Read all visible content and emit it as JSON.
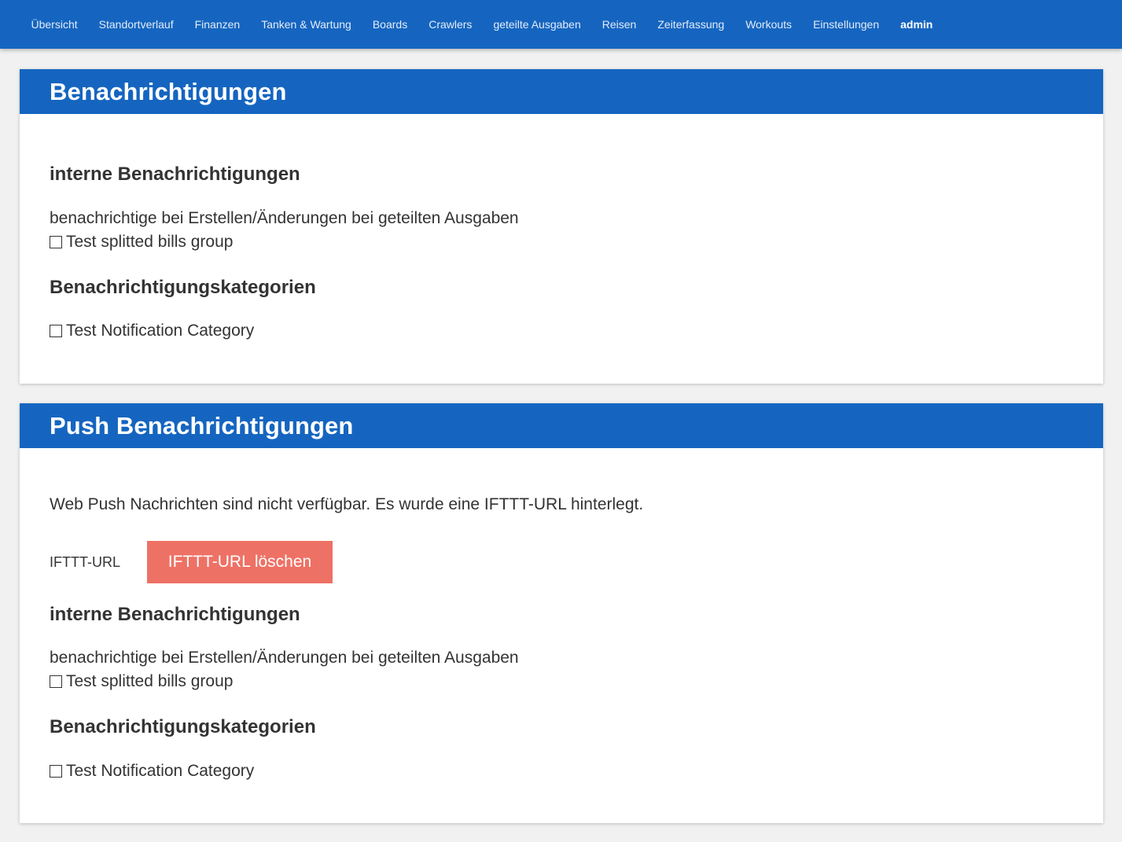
{
  "nav": {
    "items": [
      {
        "label": "Übersicht"
      },
      {
        "label": "Standortverlauf"
      },
      {
        "label": "Finanzen"
      },
      {
        "label": "Tanken & Wartung"
      },
      {
        "label": "Boards"
      },
      {
        "label": "Crawlers"
      },
      {
        "label": "geteilte Ausgaben"
      },
      {
        "label": "Reisen"
      },
      {
        "label": "Zeiterfassung"
      },
      {
        "label": "Workouts"
      },
      {
        "label": "Einstellungen"
      },
      {
        "label": "admin"
      }
    ]
  },
  "notifications": {
    "title": "Benachrichtigungen",
    "internal_heading": "interne Benachrichtigungen",
    "internal_desc": "benachrichtige bei Erstellen/Änderungen bei geteilten Ausgaben",
    "group_option": "Test splitted bills group",
    "categories_heading": "Benachrichtigungskategorien",
    "category_option": "Test Notification Category"
  },
  "push": {
    "title": "Push Benachrichtigungen",
    "info": "Web Push Nachrichten sind nicht verfügbar. Es wurde eine IFTTT-URL hinterlegt.",
    "ifttt_label": "IFTTT-URL",
    "delete_button": "IFTTT-URL löschen",
    "internal_heading": "interne Benachrichtigungen",
    "internal_desc": "benachrichtige bei Erstellen/Änderungen bei geteilten Ausgaben",
    "group_option": "Test splitted bills group",
    "categories_heading": "Benachrichtigungskategorien",
    "category_option": "Test Notification Category"
  },
  "colors": {
    "primary": "#1565c0",
    "danger_button": "#ee7165",
    "background": "#f1f1f1"
  }
}
